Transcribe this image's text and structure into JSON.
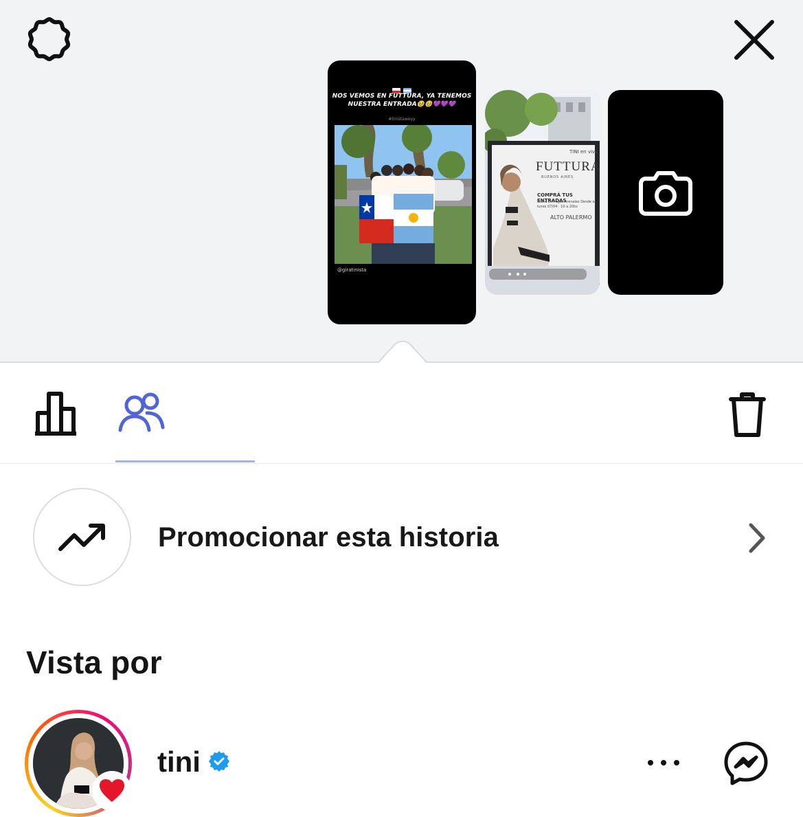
{
  "top": {
    "settings_icon": "gear-icon",
    "close_icon": "close-icon",
    "stories": [
      {
        "flags": [
          "chile-flag",
          "argentina-flag"
        ],
        "headline": "NOS VEMOS EN FUTTURA, YA TENEMOS NUESTRA ENTRADA",
        "emoji": "🥹🥹💜💜💜",
        "tag": "#tinistaweyy",
        "credit": "@giratinista"
      },
      {
        "live": "TINI en vivo",
        "poster_title": "FUTTURA",
        "poster_sub": "BUENOS AIRES",
        "poster_cta": "COMPRÁ TUS ENTRADAS",
        "poster_mini": "Stand Entregas Arenales Desde el lunes 07/04 · 10 a 20hs",
        "poster_brand": "ALTO PALERMO"
      },
      {
        "icon": "camera-icon"
      }
    ]
  },
  "tabs": {
    "insights_icon": "bar-chart-icon",
    "viewers_icon": "people-icon",
    "delete_icon": "trash-icon",
    "active": "viewers"
  },
  "promote": {
    "icon": "trending-up-icon",
    "label": "Promocionar esta historia",
    "chevron_icon": "chevron-right-icon"
  },
  "viewers": {
    "section_title": "Vista por",
    "items": [
      {
        "username": "tini",
        "verified": true,
        "reaction": "heart",
        "more_icon": "more-horizontal-icon",
        "messenger_icon": "messenger-icon"
      }
    ]
  },
  "colors": {
    "top_bg": "#f2f3f5",
    "active_tab": "#5065d8",
    "indicator": "#a7b1e8",
    "verified": "#1d9bf0",
    "heart": "#e5162a"
  }
}
